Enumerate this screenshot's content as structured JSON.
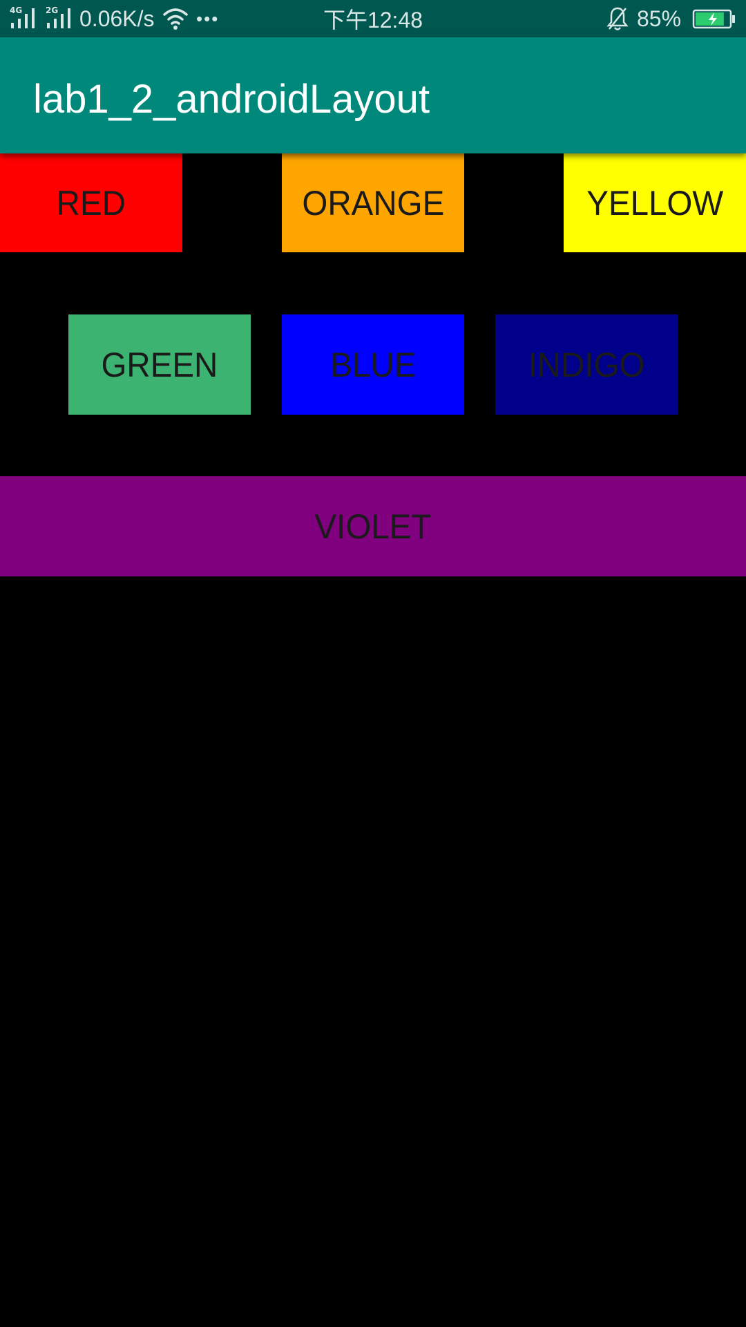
{
  "status_bar": {
    "network_1": "4G",
    "network_2": "2G",
    "speed": "0.06K/s",
    "more": "•••",
    "time": "下午12:48",
    "battery_percent": "85%",
    "battery_level": 0.85,
    "background": "#00574f"
  },
  "app_bar": {
    "title": "lab1_2_androidLayout",
    "background": "#00897b"
  },
  "rows": [
    {
      "buttons": [
        {
          "label": "RED",
          "color": "#ff0000"
        },
        {
          "label": "ORANGE",
          "color": "#ffa500"
        },
        {
          "label": "YELLOW",
          "color": "#ffff00"
        }
      ]
    },
    {
      "buttons": [
        {
          "label": "GREEN",
          "color": "#3cb371"
        },
        {
          "label": "BLUE",
          "color": "#0000ff"
        },
        {
          "label": "INDIGO",
          "color": "#00008b"
        }
      ]
    },
    {
      "buttons": [
        {
          "label": "VIOLET",
          "color": "#800080"
        }
      ]
    }
  ]
}
